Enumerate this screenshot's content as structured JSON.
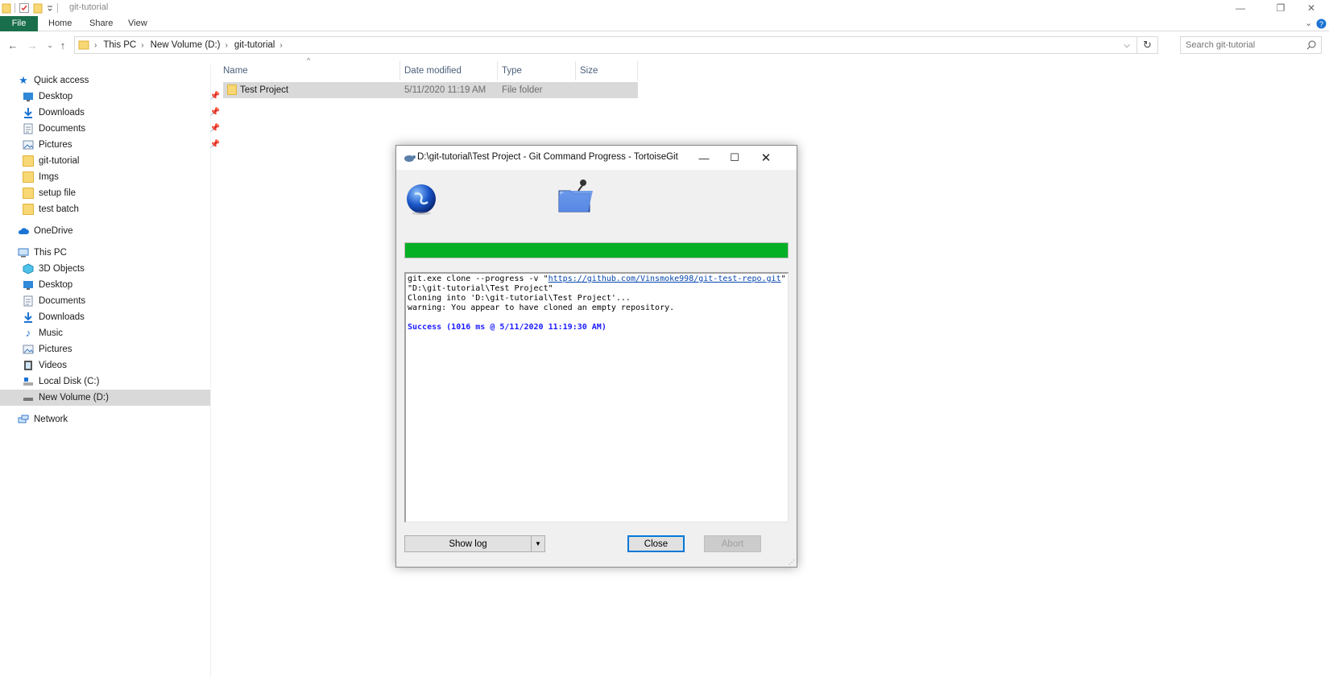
{
  "window": {
    "title": "git-tutorial",
    "controls": {
      "minimize": "—",
      "restore": "❐",
      "close": "✕"
    }
  },
  "ribbon": {
    "tabs": [
      "File",
      "Home",
      "Share",
      "View"
    ]
  },
  "address": {
    "crumbs": [
      "This PC",
      "New Volume (D:)",
      "git-tutorial"
    ],
    "search_placeholder": "Search git-tutorial"
  },
  "nav_pane": {
    "quick_access": "Quick access",
    "quick_items": [
      {
        "label": "Desktop",
        "pinned": true
      },
      {
        "label": "Downloads",
        "pinned": true
      },
      {
        "label": "Documents",
        "pinned": true
      },
      {
        "label": "Pictures",
        "pinned": true
      },
      {
        "label": "git-tutorial",
        "pinned": false
      },
      {
        "label": "Imgs",
        "pinned": false
      },
      {
        "label": "setup file",
        "pinned": false
      },
      {
        "label": "test batch",
        "pinned": false
      }
    ],
    "onedrive": "OneDrive",
    "this_pc": "This PC",
    "pc_items": [
      "3D Objects",
      "Desktop",
      "Documents",
      "Downloads",
      "Music",
      "Pictures",
      "Videos",
      "Local Disk (C:)",
      "New Volume (D:)"
    ],
    "selected": "New Volume (D:)",
    "network": "Network"
  },
  "file_list": {
    "columns": {
      "name": "Name",
      "date": "Date modified",
      "type": "Type",
      "size": "Size"
    },
    "rows": [
      {
        "name": "Test Project",
        "date": "5/11/2020 11:19 AM",
        "type": "File folder",
        "size": ""
      }
    ]
  },
  "dialog": {
    "title": "D:\\git-tutorial\\Test Project - Git Command Progress - TortoiseGit",
    "progress": 1.0,
    "progress_color": "#06b025",
    "log": {
      "cmd_prefix": "git.exe clone --progress -v \"",
      "url": "https://github.com/Vinsmoke998/git-test-repo.git",
      "cmd_suffix": "\" \"D:\\git-tutorial\\Test Project\"",
      "cloning": "Cloning into 'D:\\git-tutorial\\Test Project'...",
      "warning": "warning: You appear to have cloned an empty repository.",
      "success": "Success (1016 ms @ 5/11/2020 11:19:30 AM)"
    },
    "buttons": {
      "show_log": "Show log",
      "close": "Close",
      "abort": "Abort"
    }
  }
}
